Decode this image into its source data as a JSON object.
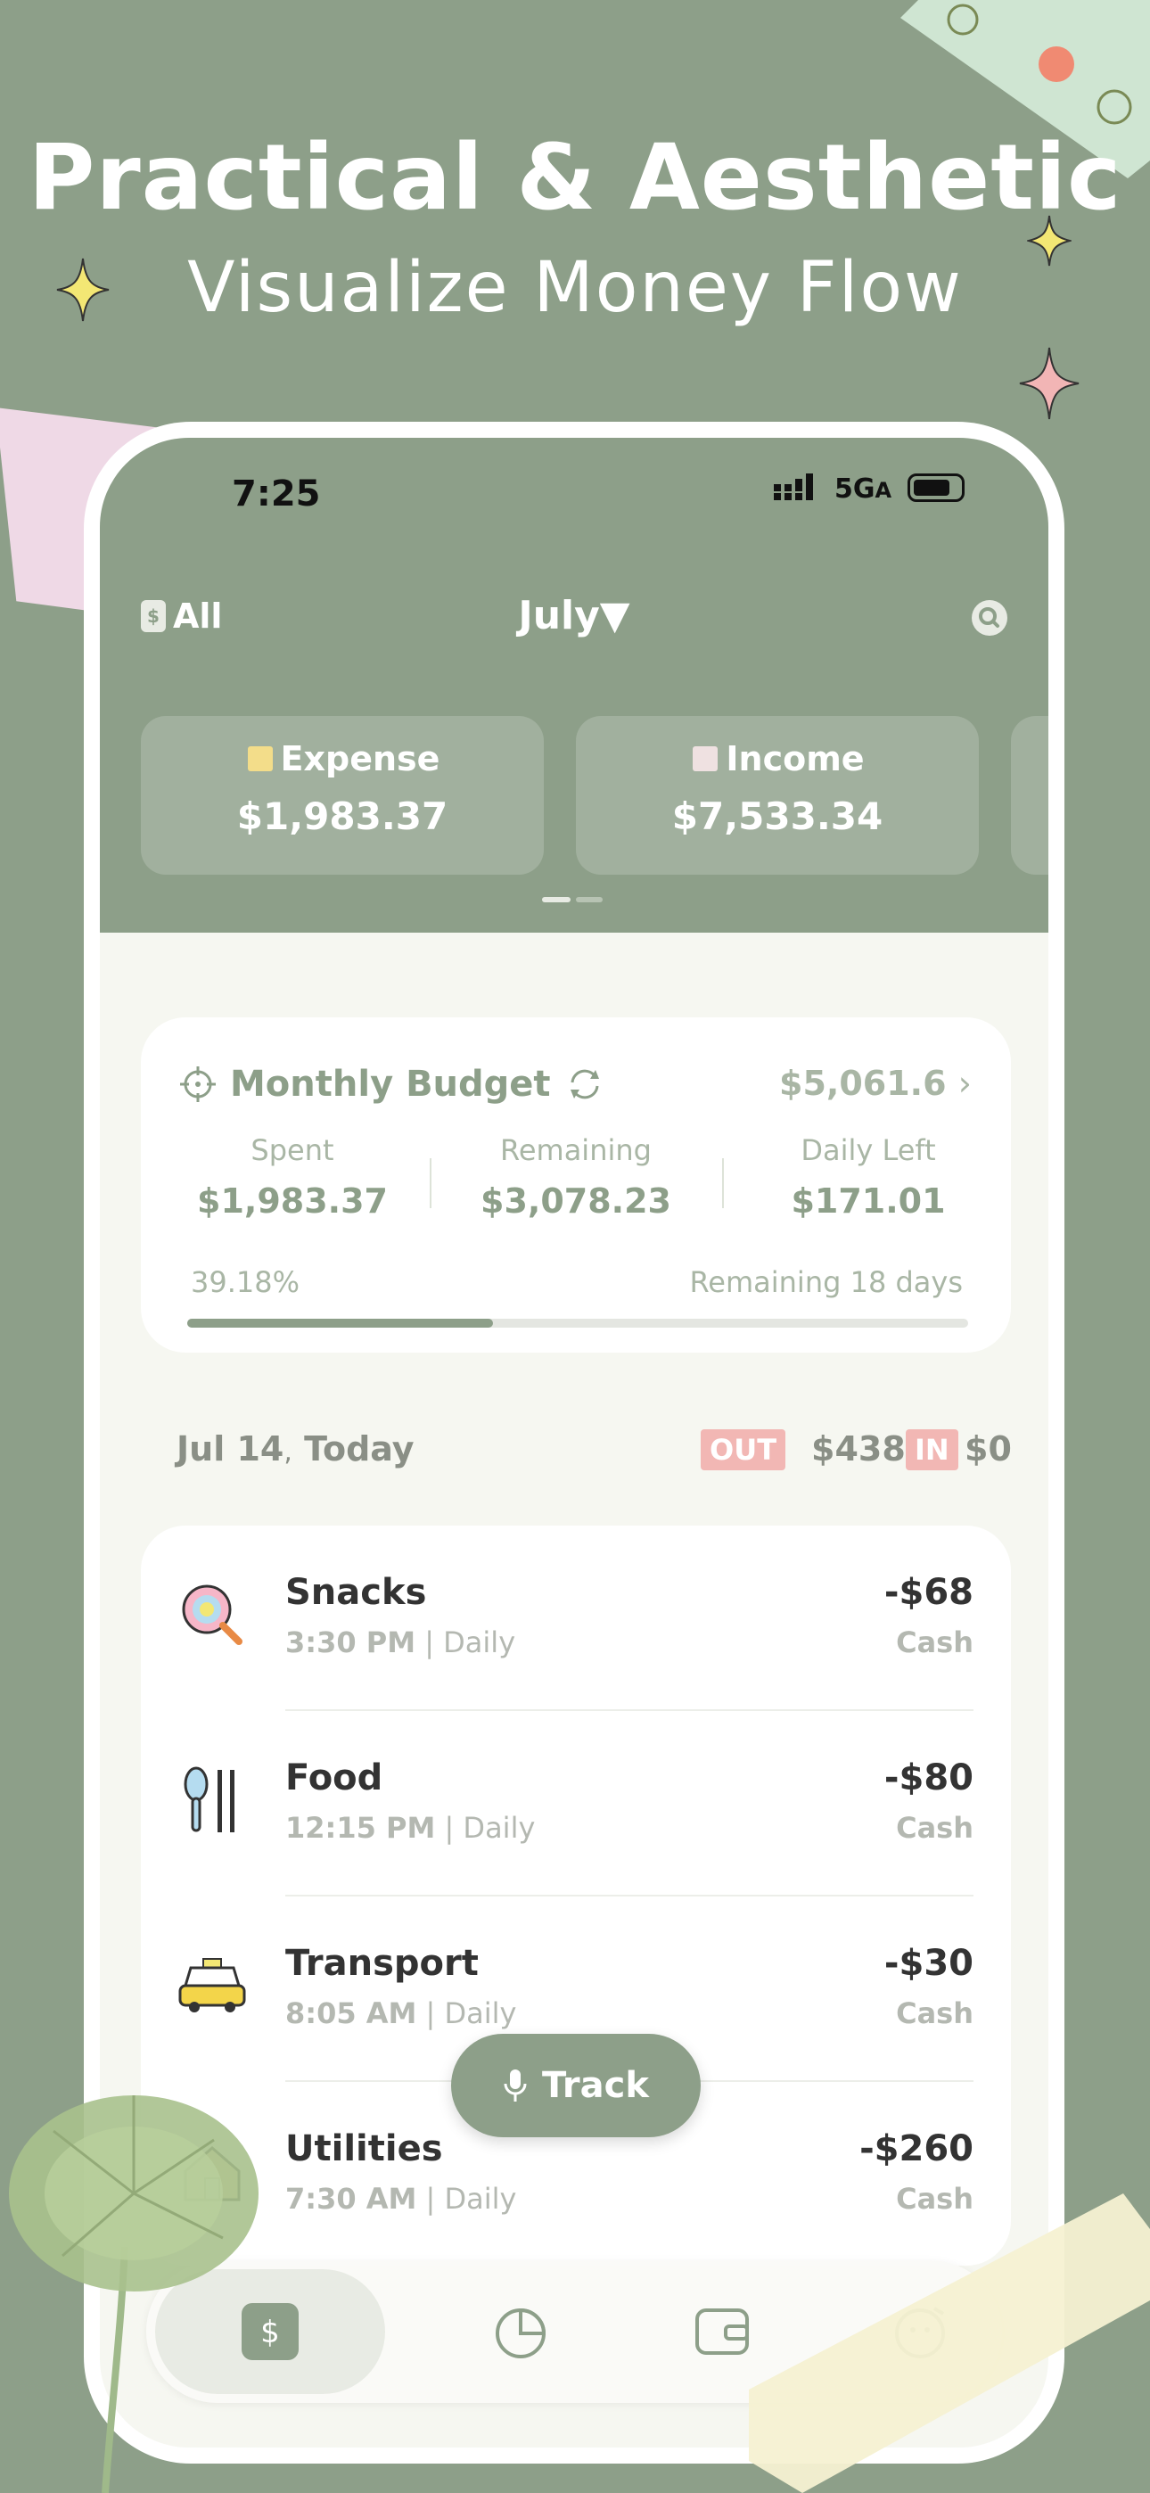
{
  "hero": {
    "title": "Practical & Aesthetic",
    "subtitle": "Visualize Money Flow"
  },
  "status": {
    "time": "7:25",
    "network": "5G",
    "network_suffix": "A"
  },
  "header": {
    "filter_label": "All",
    "filter_icon_text": "$",
    "month": "July▼"
  },
  "cards": [
    {
      "label": "Expense",
      "value": "$1,983.37"
    },
    {
      "label": "Income",
      "value": "$7,533.34"
    }
  ],
  "budget": {
    "title": "Monthly Budget",
    "total": "$5,061.6",
    "spent_label": "Spent",
    "spent": "$1,983.37",
    "remaining_label": "Remaining",
    "remaining": "$3,078.23",
    "daily_label": "Daily Left",
    "daily": "$171.01",
    "percent_text": "39.18%",
    "percent_value": 0.3918,
    "days_text": "Remaining 18 days"
  },
  "day": {
    "date": "Jul 14",
    "sep": ",",
    "label": "Today",
    "out_tag": "OUT",
    "out": "$438",
    "in_tag": "IN",
    "in": "$0"
  },
  "transactions": [
    {
      "name": "Snacks",
      "time": "3:30 PM",
      "freq": "Daily",
      "amount": "-$68",
      "method": "Cash",
      "icon": "lollipop-icon"
    },
    {
      "name": "Food",
      "time": "12:15 PM",
      "freq": "Daily",
      "amount": "-$80",
      "method": "Cash",
      "icon": "utensils-icon"
    },
    {
      "name": "Transport",
      "time": "8:05 AM",
      "freq": "Daily",
      "amount": "-$30",
      "method": "Cash",
      "icon": "taxi-icon"
    },
    {
      "name": "Utilities",
      "time": "7:30 AM",
      "freq": "Daily",
      "amount": "-$260",
      "method": "Cash",
      "icon": "house-icon"
    }
  ],
  "track_label": "Track",
  "tabs": [
    {
      "icon": "dollar-icon",
      "text": "$"
    },
    {
      "icon": "pie-chart-icon"
    },
    {
      "icon": "wallet-icon"
    },
    {
      "icon": "profile-icon"
    }
  ],
  "colors": {
    "sage": "#8d9f89",
    "pink_tag": "#f2b7b4",
    "bg": "#f6f7f1"
  }
}
